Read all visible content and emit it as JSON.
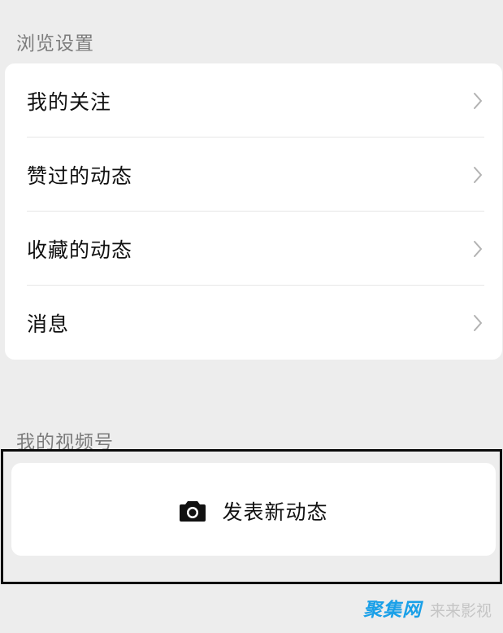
{
  "browse_settings": {
    "title": "浏览设置",
    "items": [
      {
        "label": "我的关注"
      },
      {
        "label": "赞过的动态"
      },
      {
        "label": "收藏的动态"
      },
      {
        "label": "消息"
      }
    ]
  },
  "my_channels": {
    "title": "我的视频号",
    "post_button_label": "发表新动态",
    "post_button_icon": "camera-icon"
  },
  "watermark": {
    "logo_text": "聚集网",
    "text": "来来影视"
  },
  "colors": {
    "background": "#ededed",
    "card": "#ffffff",
    "section_title": "#7c7c7c",
    "item_text": "#111111",
    "chevron": "#b2b2b2",
    "highlight_border": "#0a0a0a",
    "watermark_logo": "#1aa0e8"
  }
}
